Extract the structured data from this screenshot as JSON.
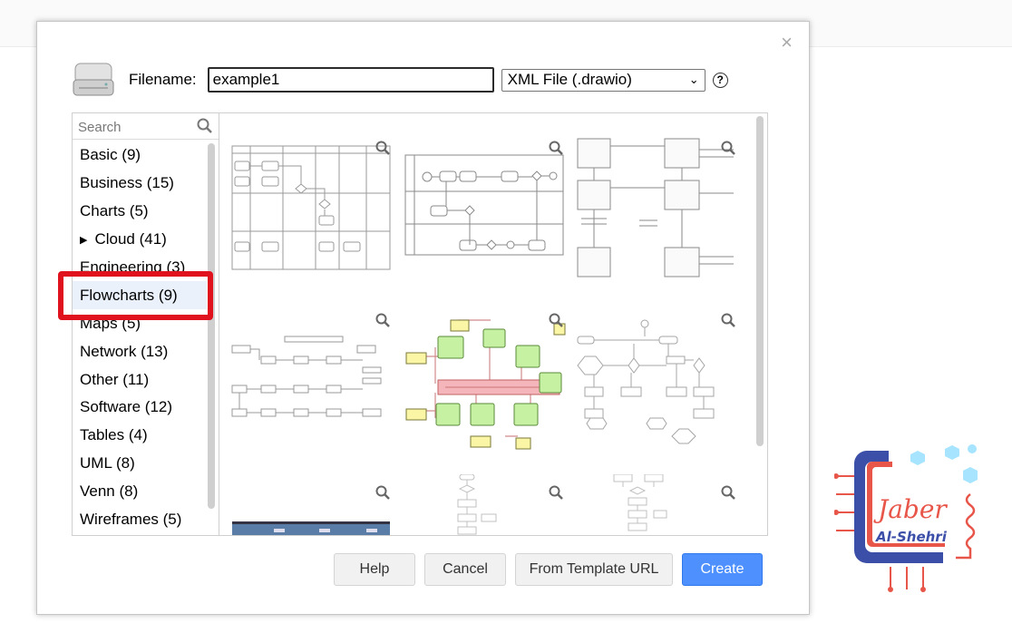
{
  "dialog": {
    "filename_label": "Filename:",
    "filename_value": "example1",
    "format_selected": "XML File (.drawio)",
    "help_symbol": "?",
    "close_symbol": "×"
  },
  "search": {
    "placeholder": "Search"
  },
  "categories": [
    {
      "label": "Basic (9)"
    },
    {
      "label": "Business (15)"
    },
    {
      "label": "Charts (5)"
    },
    {
      "label": "Cloud (41)",
      "expandable": true
    },
    {
      "label": "Engineering (3)"
    },
    {
      "label": "Flowcharts (9)",
      "selected": true
    },
    {
      "label": "Maps (5)"
    },
    {
      "label": "Network (13)"
    },
    {
      "label": "Other (11)"
    },
    {
      "label": "Software (12)"
    },
    {
      "label": "Tables (4)"
    },
    {
      "label": "UML (8)"
    },
    {
      "label": "Venn (8)"
    },
    {
      "label": "Wireframes (5)"
    }
  ],
  "buttons": {
    "help": "Help",
    "cancel": "Cancel",
    "template_url": "From Template URL",
    "create": "Create"
  },
  "watermark": {
    "name": "Jaber",
    "surname": "Al-Shehri"
  },
  "icons": [
    "drive-icon",
    "search-icon",
    "zoom-icon",
    "help-icon",
    "close-icon",
    "expand-arrow-icon"
  ],
  "colors": {
    "accent": "#4d90fe",
    "highlight": "#e0121d",
    "selected_bg": "#eaf1fb"
  }
}
